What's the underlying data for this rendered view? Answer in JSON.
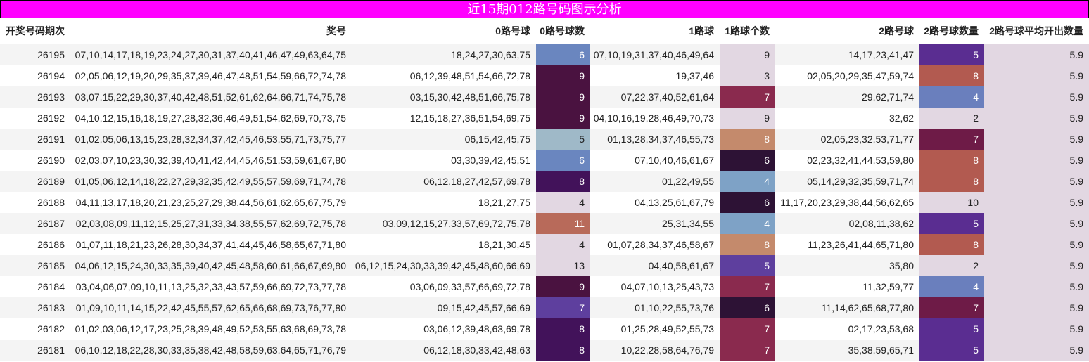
{
  "title": "近15期012路号码图示分析",
  "columns": [
    "开奖号码期次",
    "奖号",
    "0路号球",
    "0路号球数",
    "1路球",
    "1路球个数",
    "2路号球",
    "2路号球数量",
    "2路号球平均开出数量"
  ],
  "colors": {
    "title_bg": "#ff00ff",
    "avg_bg": "#e2d7e2",
    "count_scale": {
      "2": "#e2d7e2",
      "3": "#e2d7e2",
      "4": "#6a7fbd",
      "5": "#5a2d91",
      "6": "#2d1235",
      "7": "#6e1b47",
      "8": "#b25a50",
      "9": "#4a1240",
      "10": "#e2d7e2",
      "11": "#b86a5a",
      "13": "#e2d7e2"
    }
  },
  "rows": [
    {
      "period": "26195",
      "numbers": "07,10,14,17,18,19,23,24,27,30,31,37,40,41,46,47,49,63,64,75",
      "r0": "18,24,27,30,63,75",
      "c0": "6",
      "c0_color": "#6a86bf",
      "r1": "07,10,19,31,37,40,46,49,64",
      "c1": "9",
      "c1_color": "#e2d7e2",
      "r2": "14,17,23,41,47",
      "c2": "5",
      "c2_color": "#5a2d91",
      "avg": "5.9"
    },
    {
      "period": "26194",
      "numbers": "02,05,06,12,19,20,29,35,37,39,46,47,48,51,54,59,66,72,74,78",
      "r0": "06,12,39,48,51,54,66,72,78",
      "c0": "9",
      "c0_color": "#4a1240",
      "r1": "19,37,46",
      "c1": "3",
      "c1_color": "#e2d7e2",
      "r2": "02,05,20,29,35,47,59,74",
      "c2": "8",
      "c2_color": "#b25a50",
      "avg": "5.9"
    },
    {
      "period": "26193",
      "numbers": "03,07,15,22,29,30,37,40,42,48,51,52,61,62,64,66,71,74,75,78",
      "r0": "03,15,30,42,48,51,66,75,78",
      "c0": "9",
      "c0_color": "#4a1240",
      "r1": "07,22,37,40,52,61,64",
      "c1": "7",
      "c1_color": "#8a2a4e",
      "r2": "29,62,71,74",
      "c2": "4",
      "c2_color": "#6a7fbd",
      "avg": "5.9"
    },
    {
      "period": "26192",
      "numbers": "04,10,12,15,16,18,19,27,28,32,36,46,49,51,54,62,69,70,73,75",
      "r0": "12,15,18,27,36,51,54,69,75",
      "c0": "9",
      "c0_color": "#4a1240",
      "r1": "04,10,16,19,28,46,49,70,73",
      "c1": "9",
      "c1_color": "#e2d7e2",
      "r2": "32,62",
      "c2": "2",
      "c2_color": "#e2d7e2",
      "avg": "5.9"
    },
    {
      "period": "26191",
      "numbers": "01,02,05,06,13,15,23,28,32,34,37,42,45,46,53,55,71,73,75,77",
      "r0": "06,15,42,45,75",
      "c0": "5",
      "c0_color": "#9fb9c8",
      "r1": "01,13,28,34,37,46,55,73",
      "c1": "8",
      "c1_color": "#c48a6c",
      "r2": "02,05,23,32,53,71,77",
      "c2": "7",
      "c2_color": "#6e1b47",
      "avg": "5.9"
    },
    {
      "period": "26190",
      "numbers": "02,03,07,10,23,30,32,39,40,41,42,44,45,46,51,53,59,61,67,80",
      "r0": "03,30,39,42,45,51",
      "c0": "6",
      "c0_color": "#6a86bf",
      "r1": "07,10,40,46,61,67",
      "c1": "6",
      "c1_color": "#2d1235",
      "r2": "02,23,32,41,44,53,59,80",
      "c2": "8",
      "c2_color": "#b25a50",
      "avg": "5.9"
    },
    {
      "period": "26189",
      "numbers": "01,05,06,12,14,18,22,27,29,32,35,42,49,55,57,59,69,71,74,78",
      "r0": "06,12,18,27,42,57,69,78",
      "c0": "8",
      "c0_color": "#42125a",
      "r1": "01,22,49,55",
      "c1": "4",
      "c1_color": "#7ea2c6",
      "r2": "05,14,29,32,35,59,71,74",
      "c2": "8",
      "c2_color": "#b25a50",
      "avg": "5.9"
    },
    {
      "period": "26188",
      "numbers": "04,11,13,17,18,20,21,23,25,27,29,38,44,56,61,62,65,67,75,79",
      "r0": "18,21,27,75",
      "c0": "4",
      "c0_color": "#e2d7e2",
      "r1": "04,13,25,61,67,79",
      "c1": "6",
      "c1_color": "#2d1235",
      "r2": "11,17,20,23,29,38,44,56,62,65",
      "c2": "10",
      "c2_color": "#e2d7e2",
      "avg": "5.9"
    },
    {
      "period": "26187",
      "numbers": "02,03,08,09,11,12,15,25,27,31,33,34,38,55,57,62,69,72,75,78",
      "r0": "03,09,12,15,27,33,57,69,72,75,78",
      "c0": "11",
      "c0_color": "#b86a5a",
      "r1": "25,31,34,55",
      "c1": "4",
      "c1_color": "#7ea2c6",
      "r2": "02,08,11,38,62",
      "c2": "5",
      "c2_color": "#5a2d91",
      "avg": "5.9"
    },
    {
      "period": "26186",
      "numbers": "01,07,11,18,21,23,26,28,30,34,37,41,44,45,46,58,65,67,71,80",
      "r0": "18,21,30,45",
      "c0": "4",
      "c0_color": "#e2d7e2",
      "r1": "01,07,28,34,37,46,58,67",
      "c1": "8",
      "c1_color": "#c48a6c",
      "r2": "11,23,26,41,44,65,71,80",
      "c2": "8",
      "c2_color": "#b25a50",
      "avg": "5.9"
    },
    {
      "period": "26185",
      "numbers": "04,06,12,15,24,30,33,35,39,40,42,45,48,58,60,61,66,67,69,80",
      "r0": "06,12,15,24,30,33,39,42,45,48,60,66,69",
      "c0": "13",
      "c0_color": "#e2d7e2",
      "r1": "04,40,58,61,67",
      "c1": "5",
      "c1_color": "#5e3f9e",
      "r2": "35,80",
      "c2": "2",
      "c2_color": "#e2d7e2",
      "avg": "5.9"
    },
    {
      "period": "26184",
      "numbers": "03,04,06,07,09,10,11,13,25,32,33,43,57,59,66,69,72,73,77,78",
      "r0": "03,06,09,33,57,66,69,72,78",
      "c0": "9",
      "c0_color": "#4a1240",
      "r1": "04,07,10,13,25,43,73",
      "c1": "7",
      "c1_color": "#8a2a4e",
      "r2": "11,32,59,77",
      "c2": "4",
      "c2_color": "#6a7fbd",
      "avg": "5.9"
    },
    {
      "period": "26183",
      "numbers": "01,09,10,11,14,15,22,42,45,55,57,62,65,66,68,69,73,76,77,80",
      "r0": "09,15,42,45,57,66,69",
      "c0": "7",
      "c0_color": "#5e3f9e",
      "r1": "01,10,22,55,73,76",
      "c1": "6",
      "c1_color": "#2d1235",
      "r2": "11,14,62,65,68,77,80",
      "c2": "7",
      "c2_color": "#6e1b47",
      "avg": "5.9"
    },
    {
      "period": "26182",
      "numbers": "01,02,03,06,12,17,23,25,28,39,48,49,52,53,55,63,68,69,73,78",
      "r0": "03,06,12,39,48,63,69,78",
      "c0": "8",
      "c0_color": "#42125a",
      "r1": "01,25,28,49,52,55,73",
      "c1": "7",
      "c1_color": "#8a2a4e",
      "r2": "02,17,23,53,68",
      "c2": "5",
      "c2_color": "#5a2d91",
      "avg": "5.9"
    },
    {
      "period": "26181",
      "numbers": "06,10,12,18,22,28,30,33,35,38,42,48,58,59,63,64,65,71,76,79",
      "r0": "06,12,18,30,33,42,48,63",
      "c0": "8",
      "c0_color": "#42125a",
      "r1": "10,22,28,58,64,76,79",
      "c1": "7",
      "c1_color": "#8a2a4e",
      "r2": "35,38,59,65,71",
      "c2": "5",
      "c2_color": "#5a2d91",
      "avg": "5.9"
    }
  ]
}
